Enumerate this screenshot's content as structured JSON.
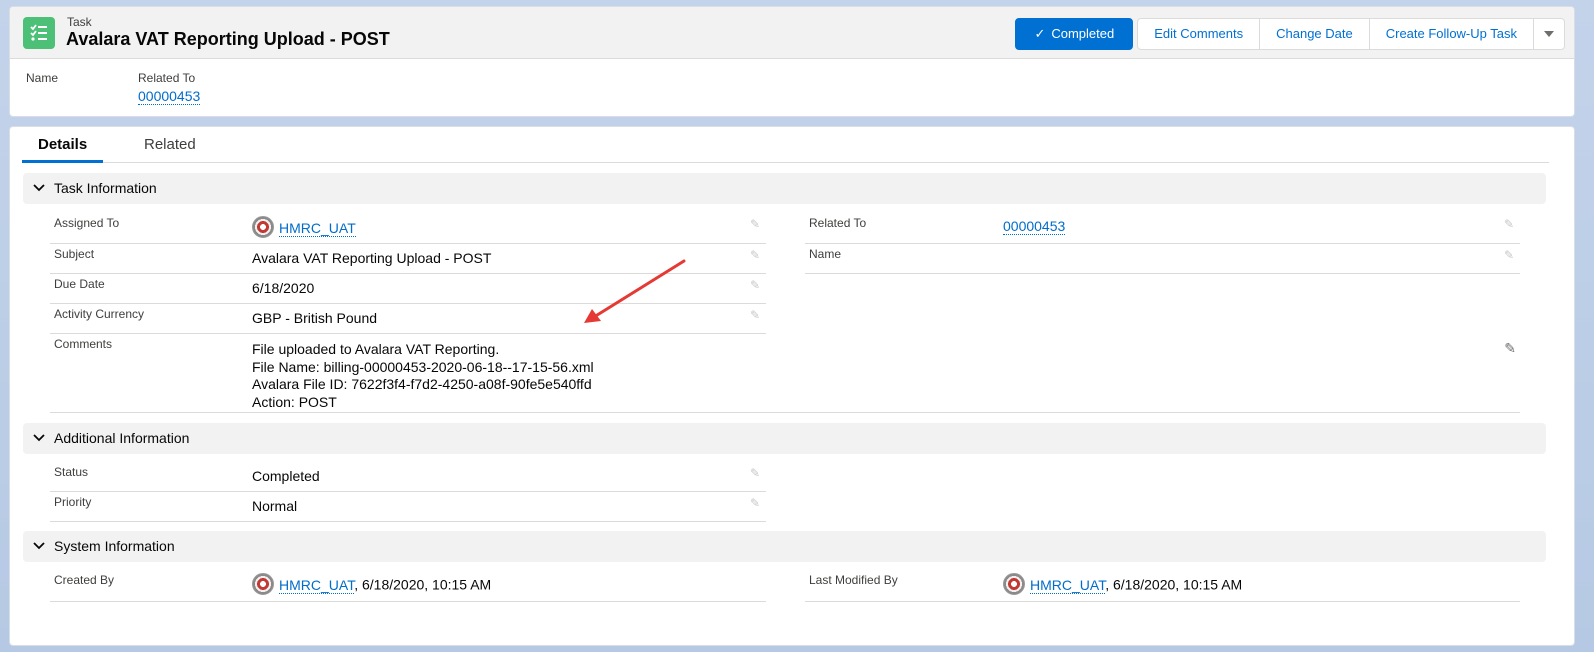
{
  "header": {
    "object_label": "Task",
    "title": "Avalara VAT Reporting Upload - POST",
    "buttons": {
      "completed": "Completed",
      "edit_comments": "Edit Comments",
      "change_date": "Change Date",
      "create_follow_up": "Create Follow-Up Task"
    },
    "highlights": {
      "name_label": "Name",
      "related_to_label": "Related To",
      "related_to_value": "00000453"
    }
  },
  "tabs": [
    "Details",
    "Related"
  ],
  "sections": {
    "task_information": {
      "title": "Task Information",
      "assigned_to_label": "Assigned To",
      "assigned_to_value": "HMRC_UAT",
      "subject_label": "Subject",
      "subject_value": "Avalara VAT Reporting Upload - POST",
      "due_date_label": "Due Date",
      "due_date_value": "6/18/2020",
      "activity_currency_label": "Activity Currency",
      "activity_currency_value": "GBP - British Pound",
      "comments_label": "Comments",
      "comments_line1": "File uploaded to Avalara VAT Reporting.",
      "comments_line2": "File Name: billing-00000453-2020-06-18--17-15-56.xml",
      "comments_line3": "Avalara File ID: 7622f3f4-f7d2-4250-a08f-90fe5e540ffd",
      "comments_line4": "Action: POST",
      "related_to_label": "Related To",
      "related_to_value": "00000453",
      "name_label": "Name"
    },
    "additional_information": {
      "title": "Additional Information",
      "status_label": "Status",
      "status_value": "Completed",
      "priority_label": "Priority",
      "priority_value": "Normal"
    },
    "system_information": {
      "title": "System Information",
      "created_by_label": "Created By",
      "created_by_user": "HMRC_UAT",
      "created_by_date": ", 6/18/2020, 10:15 AM",
      "last_modified_label": "Last Modified By",
      "last_modified_user": "HMRC_UAT",
      "last_modified_date": ", 6/18/2020, 10:15 AM"
    }
  },
  "colors": {
    "brand": "#0070d2",
    "link": "#006dcc",
    "task_icon": "#4bc076",
    "annotation_arrow": "#e53935"
  }
}
